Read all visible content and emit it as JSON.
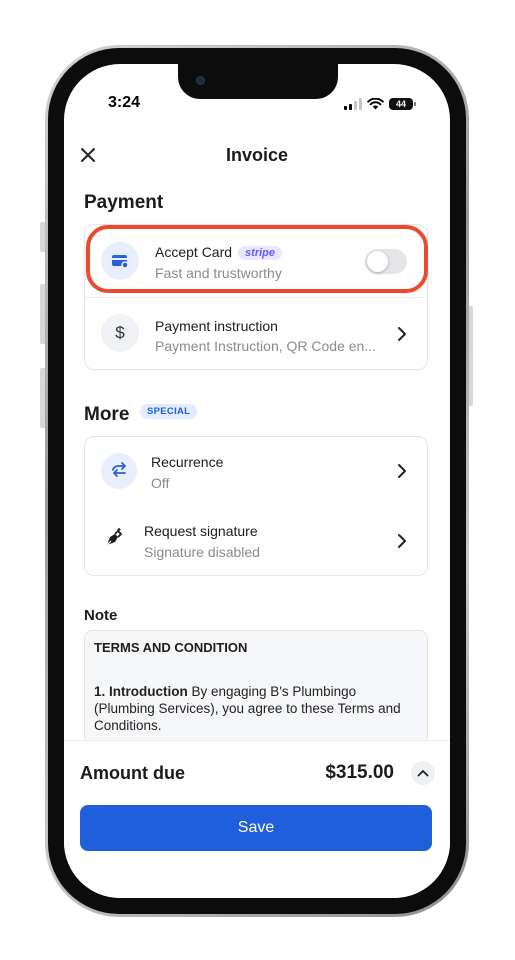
{
  "status_bar": {
    "time": "3:24",
    "battery": "44"
  },
  "header": {
    "title": "Invoice"
  },
  "payment": {
    "section_title": "Payment",
    "accept_card": {
      "title": "Accept Card",
      "badge": "stripe",
      "subtitle": "Fast and trustworthy",
      "enabled": false
    },
    "payment_instruction": {
      "title": "Payment instruction",
      "subtitle": "Payment Instruction, QR Code en..."
    }
  },
  "more": {
    "section_title": "More",
    "badge": "SPECIAL",
    "recurrence": {
      "title": "Recurrence",
      "subtitle": "Off"
    },
    "request_signature": {
      "title": "Request signature",
      "subtitle": "Signature disabled"
    }
  },
  "note": {
    "label": "Note",
    "heading": "TERMS AND CONDITION",
    "intro_bold": "1. Introduction",
    "intro_text": " By engaging B's Plumbingo (Plumbing Services), you agree to these Terms and Conditions."
  },
  "footer": {
    "amount_label": "Amount due",
    "amount_value": "$315.00",
    "save_label": "Save"
  },
  "colors": {
    "accent": "#1f5fdc",
    "highlight": "#ec4a2a",
    "stripe": "#635bff"
  },
  "icons": {
    "close": "close-icon",
    "card": "credit-card-icon",
    "dollar": "dollar-icon",
    "recurrence": "repeat-icon",
    "signature": "pen-nib-icon",
    "chevron": "chevron-right-icon",
    "collapse": "chevron-up-icon"
  }
}
